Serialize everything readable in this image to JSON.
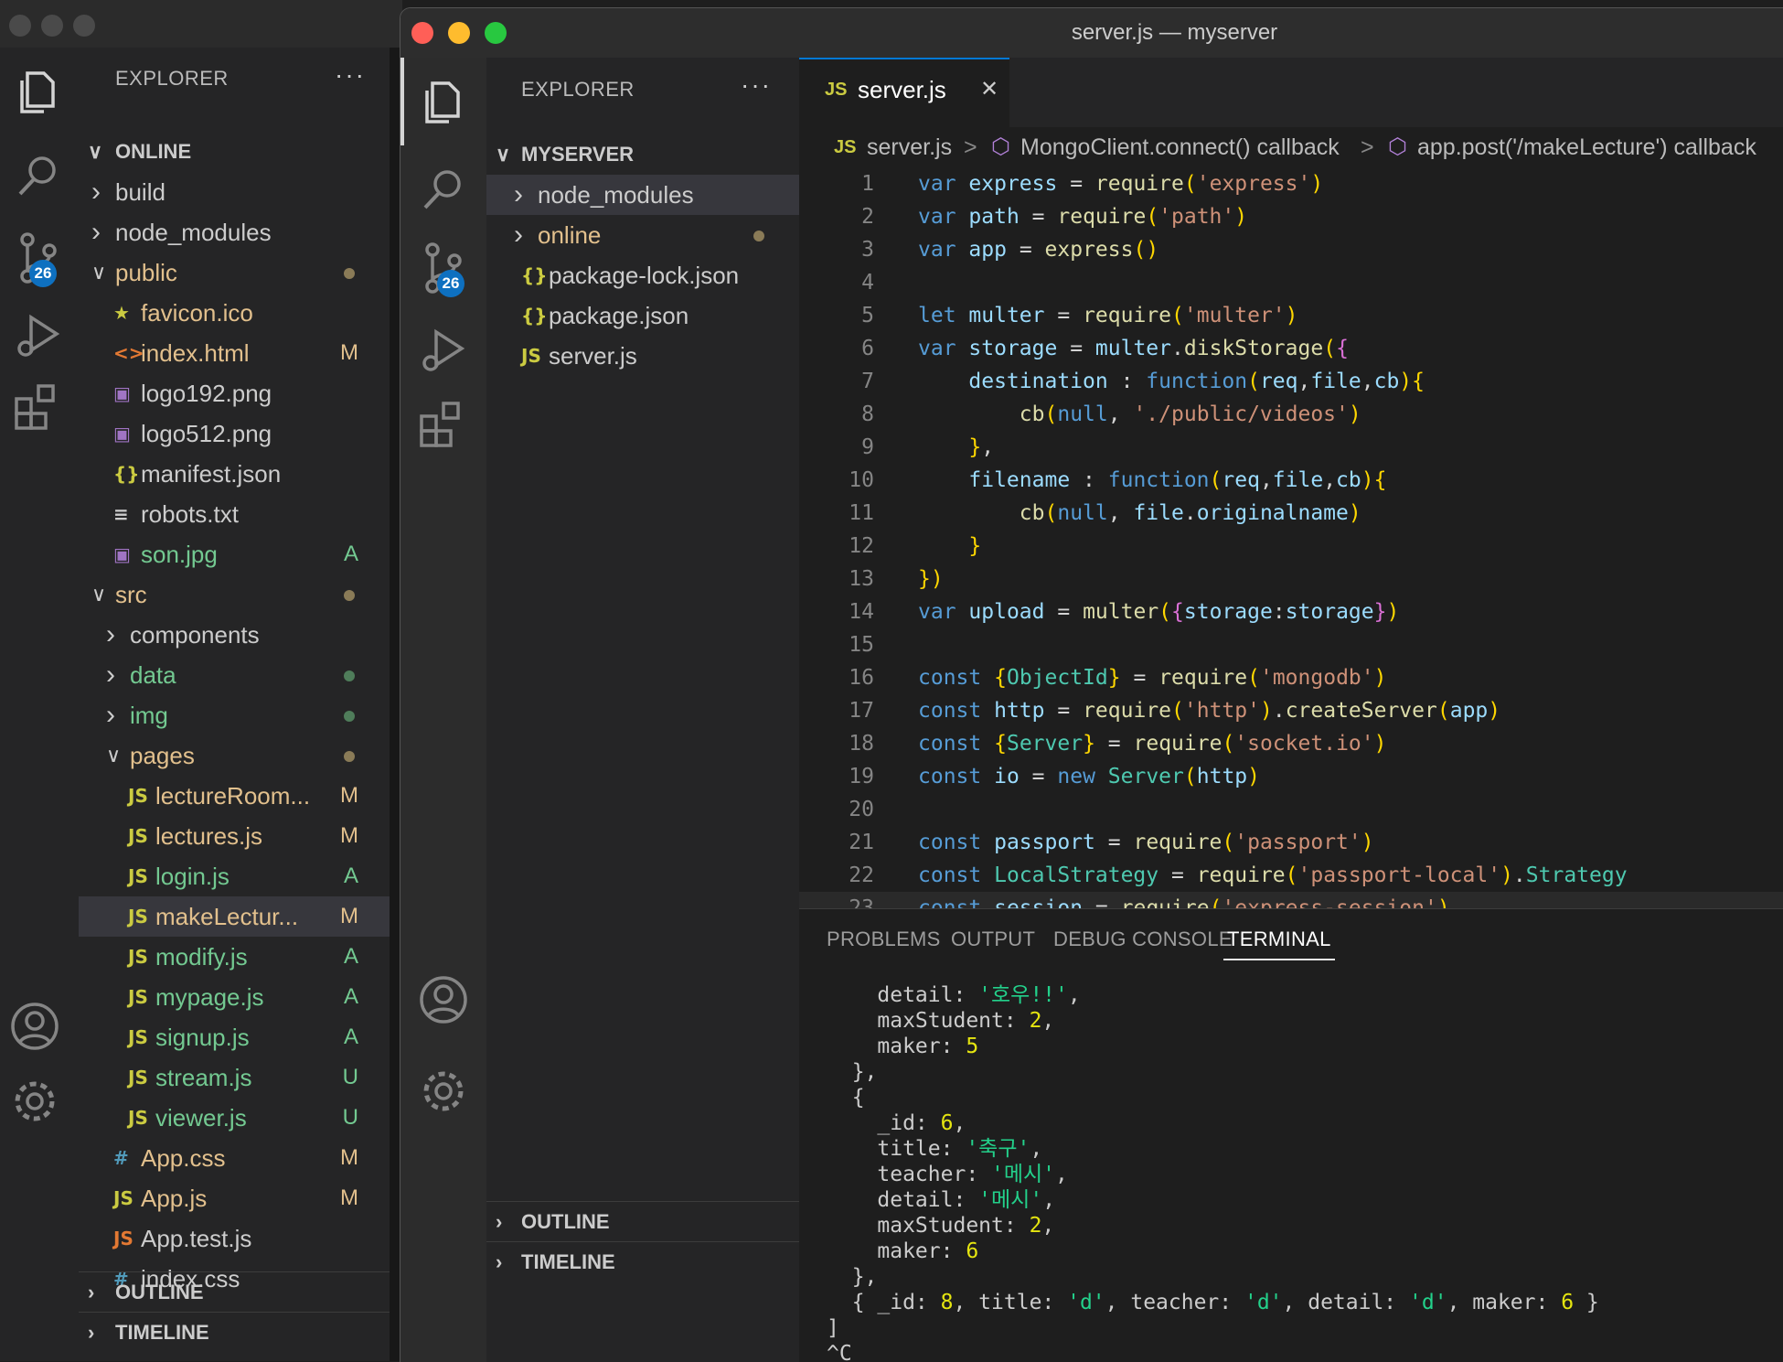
{
  "bg": {
    "explorer_title": "EXPLORER",
    "dots": "···",
    "root": "ONLINE",
    "badge_count": "26",
    "items": [
      {
        "name": "build",
        "type": "folder",
        "open": false,
        "depth": 1,
        "badge": "",
        "dot": ""
      },
      {
        "name": "node_modules",
        "type": "folder",
        "open": false,
        "depth": 1,
        "badge": "",
        "dot": ""
      },
      {
        "name": "public",
        "type": "folder",
        "open": true,
        "depth": 1,
        "badge": "",
        "dot": "#8a7b57",
        "color": "#e2c08d"
      },
      {
        "name": "favicon.ico",
        "type": "star",
        "depth": 2,
        "badge": "",
        "dot": "",
        "color": "#e2c08d"
      },
      {
        "name": "index.html",
        "type": "html",
        "depth": 2,
        "badge": "M",
        "dot": "",
        "color": "#e2c08d"
      },
      {
        "name": "logo192.png",
        "type": "image",
        "depth": 2,
        "badge": "",
        "dot": ""
      },
      {
        "name": "logo512.png",
        "type": "image",
        "depth": 2,
        "badge": "",
        "dot": ""
      },
      {
        "name": "manifest.json",
        "type": "json",
        "depth": 2,
        "badge": "",
        "dot": ""
      },
      {
        "name": "robots.txt",
        "type": "text",
        "depth": 2,
        "badge": "",
        "dot": ""
      },
      {
        "name": "son.jpg",
        "type": "image",
        "depth": 2,
        "badge": "A",
        "dot": "",
        "color": "#73c991"
      },
      {
        "name": "src",
        "type": "folder",
        "open": true,
        "depth": 1,
        "badge": "",
        "dot": "#8a7b57",
        "color": "#e2c08d"
      },
      {
        "name": "components",
        "type": "folder",
        "open": false,
        "depth": 2,
        "badge": "",
        "dot": ""
      },
      {
        "name": "data",
        "type": "folder",
        "open": false,
        "depth": 2,
        "badge": "",
        "dot": "#4f7d5a",
        "color": "#73c991"
      },
      {
        "name": "img",
        "type": "folder",
        "open": false,
        "depth": 2,
        "badge": "",
        "dot": "#4f7d5a",
        "color": "#73c991"
      },
      {
        "name": "pages",
        "type": "folder",
        "open": true,
        "depth": 2,
        "badge": "",
        "dot": "#8a7b57",
        "color": "#e2c08d"
      },
      {
        "name": "lectureRoom...",
        "type": "js",
        "depth": 3,
        "badge": "M",
        "dot": "",
        "color": "#e2c08d"
      },
      {
        "name": "lectures.js",
        "type": "js",
        "depth": 3,
        "badge": "M",
        "dot": "",
        "color": "#e2c08d"
      },
      {
        "name": "login.js",
        "type": "js",
        "depth": 3,
        "badge": "A",
        "dot": "",
        "color": "#73c991"
      },
      {
        "name": "makeLectur...",
        "type": "js",
        "depth": 3,
        "badge": "M",
        "dot": "",
        "color": "#e2c08d",
        "selected": true
      },
      {
        "name": "modify.js",
        "type": "js",
        "depth": 3,
        "badge": "A",
        "dot": "",
        "color": "#73c991"
      },
      {
        "name": "mypage.js",
        "type": "js",
        "depth": 3,
        "badge": "A",
        "dot": "",
        "color": "#73c991"
      },
      {
        "name": "signup.js",
        "type": "js",
        "depth": 3,
        "badge": "A",
        "dot": "",
        "color": "#73c991"
      },
      {
        "name": "stream.js",
        "type": "js",
        "depth": 3,
        "badge": "U",
        "dot": "",
        "color": "#73c991"
      },
      {
        "name": "viewer.js",
        "type": "js",
        "depth": 3,
        "badge": "U",
        "dot": "",
        "color": "#73c991"
      },
      {
        "name": "App.css",
        "type": "css",
        "depth": 2,
        "badge": "M",
        "dot": "",
        "color": "#e2c08d"
      },
      {
        "name": "App.js",
        "type": "js",
        "depth": 2,
        "badge": "M",
        "dot": "",
        "color": "#e2c08d"
      },
      {
        "name": "App.test.js",
        "type": "jso",
        "depth": 2,
        "badge": "",
        "dot": ""
      },
      {
        "name": "index.css",
        "type": "css",
        "depth": 2,
        "badge": "",
        "dot": ""
      }
    ],
    "outline": "OUTLINE",
    "timeline": "TIMELINE"
  },
  "fg": {
    "title": "server.js — myserver",
    "explorer_title": "EXPLORER",
    "dots": "···",
    "root": "MYSERVER",
    "badge_count": "26",
    "items": [
      {
        "name": "node_modules",
        "type": "folder",
        "open": false,
        "selected": true
      },
      {
        "name": "online",
        "type": "folder",
        "open": false,
        "color": "#e2c08d",
        "dot": "#8a7b57"
      },
      {
        "name": "package-lock.json",
        "type": "json"
      },
      {
        "name": "package.json",
        "type": "json"
      },
      {
        "name": "server.js",
        "type": "js"
      }
    ],
    "outline": "OUTLINE",
    "timeline": "TIMELINE",
    "tab": {
      "icon": "JS",
      "label": "server.js",
      "close": "✕"
    },
    "breadcrumb": {
      "file": "server.js",
      "sep": ">",
      "sym1": "MongoClient.connect() callback",
      "sym2": "app.post('/makeLecture') callback"
    },
    "panel_tabs": [
      "PROBLEMS",
      "OUTPUT",
      "DEBUG CONSOLE",
      "TERMINAL"
    ],
    "active_panel_tab": "TERMINAL"
  },
  "code_lines": [
    "var express = require('express')",
    "var path = require('path')",
    "var app = express()",
    "",
    "let multer = require('multer')",
    "var storage = multer.diskStorage({",
    "    destination : function(req,file,cb){",
    "        cb(null, './public/videos')",
    "    },",
    "    filename : function(req,file,cb){",
    "        cb(null, file.originalname)",
    "    }",
    "})",
    "var upload = multer({storage:storage})",
    "",
    "const {ObjectId} = require('mongodb')",
    "const http = require('http').createServer(app)",
    "const {Server} = require('socket.io')",
    "const io = new Server(http)",
    "",
    "const passport = require('passport')",
    "const LocalStrategy = require('passport-local').Strategy",
    "const session = require('express-session')"
  ],
  "terminal_lines": [
    "    detail: '호우!!',",
    "    maxStudent: 2,",
    "    maker: 5",
    "  },",
    "  {",
    "    _id: 6,",
    "    title: '축구',",
    "    teacher: '메시',",
    "    detail: '메시',",
    "    maxStudent: 2,",
    "    maker: 6",
    "  },",
    "  { _id: 8, title: 'd', teacher: 'd', detail: 'd', maker: 6 }",
    "]",
    "^C"
  ]
}
